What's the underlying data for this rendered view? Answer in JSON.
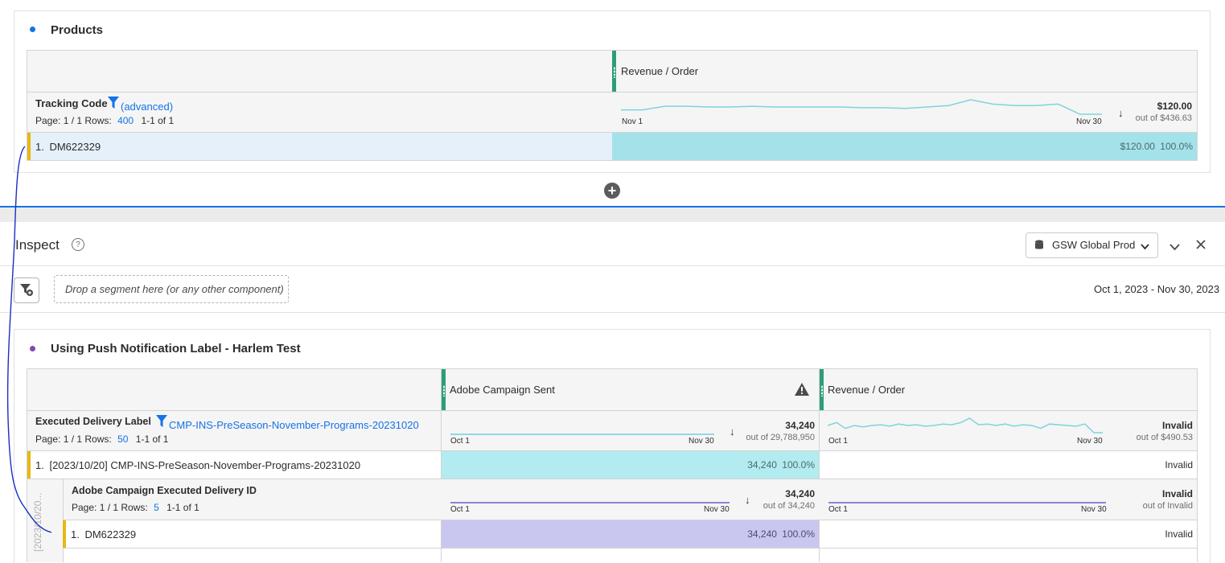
{
  "products_panel": {
    "title": "Products",
    "metric_header": "Revenue / Order",
    "dimension": {
      "name": "Tracking Code",
      "filter_text": "(advanced)",
      "page": "Page: 1 / 1",
      "rows_label": "Rows:",
      "rows_value": "400",
      "range": "1-1 of 1"
    },
    "sparkline": {
      "start": "Nov 1",
      "end": "Nov 30",
      "values": [
        0.3,
        0.3,
        0.55,
        0.55,
        0.5,
        0.5,
        0.55,
        0.5,
        0.5,
        0.5,
        0.5,
        0.45,
        0.45,
        0.4,
        0.5,
        0.6,
        1.0,
        0.7,
        0.6,
        0.6,
        0.7,
        0.0,
        0.0
      ]
    },
    "total": {
      "value": "$120.00",
      "out_of": "out of $436.63"
    },
    "row": {
      "index": "1.",
      "label": "DM622329",
      "value": "$120.00",
      "pct": "100.0%"
    }
  },
  "inspect": {
    "title": "Inspect",
    "help_icon": "help-icon",
    "dataview": "GSW Global Prod",
    "drop_zone": "Drop a segment here (or any other component)",
    "date_range": "Oct 1, 2023 - Nov 30, 2023"
  },
  "push_panel": {
    "title": "Using Push Notification Label - Harlem Test",
    "col1_header": "Adobe Campaign Sent",
    "col2_header": "Revenue / Order",
    "dimension": {
      "name": "Executed Delivery Label",
      "filter_text": "CMP-INS-PreSeason-November-Programs-20231020",
      "page": "Page: 1 / 1",
      "rows_label": "Rows:",
      "rows_value": "50",
      "range": "1-1 of 1"
    },
    "spark1": {
      "start": "Oct 1",
      "end": "Nov 30"
    },
    "spark2": {
      "start": "Oct 1",
      "end": "Nov 30",
      "values": [
        0.5,
        0.7,
        0.3,
        0.5,
        0.4,
        0.5,
        0.55,
        0.45,
        0.6,
        0.5,
        0.55,
        0.45,
        0.5,
        0.6,
        0.55,
        0.7,
        1.0,
        0.55,
        0.6,
        0.5,
        0.6,
        0.45,
        0.55,
        0.5,
        0.3,
        0.6,
        0.55,
        0.5,
        0.45,
        0.6,
        0.0,
        0.0
      ]
    },
    "total1": {
      "value": "34,240",
      "out_of": "out of 29,788,950"
    },
    "total2": {
      "value": "Invalid",
      "out_of": "out of $490.53"
    },
    "row": {
      "index": "1.",
      "label": "[2023/10/20] CMP-INS-PreSeason-November-Programs-20231020",
      "value": "34,240",
      "pct": "100.0%",
      "value2": "Invalid"
    },
    "breakdown": {
      "side_label": "[2023/10/20...",
      "name": "Adobe Campaign Executed Delivery ID",
      "page": "Page: 1 / 1",
      "rows_label": "Rows:",
      "rows_value": "5",
      "range": "1-1 of 1",
      "spark1": {
        "start": "Oct 1",
        "end": "Nov 30"
      },
      "spark2": {
        "start": "Oct 1",
        "end": "Nov 30"
      },
      "total1": {
        "value": "34,240",
        "out_of": "out of 34,240"
      },
      "total2": {
        "value": "Invalid",
        "out_of": "out of Invalid"
      },
      "row": {
        "index": "1.",
        "label": "DM622329",
        "value": "34,240",
        "pct": "100.0%",
        "value2": "Invalid"
      }
    }
  },
  "colors": {
    "teal_bar": "#a4e2ea",
    "teal_light": "#b2ebf0",
    "lavender_bar": "#c9c6ef",
    "blue": "#1473e6",
    "green": "#2d9d78",
    "purple": "#7e4bb0"
  }
}
